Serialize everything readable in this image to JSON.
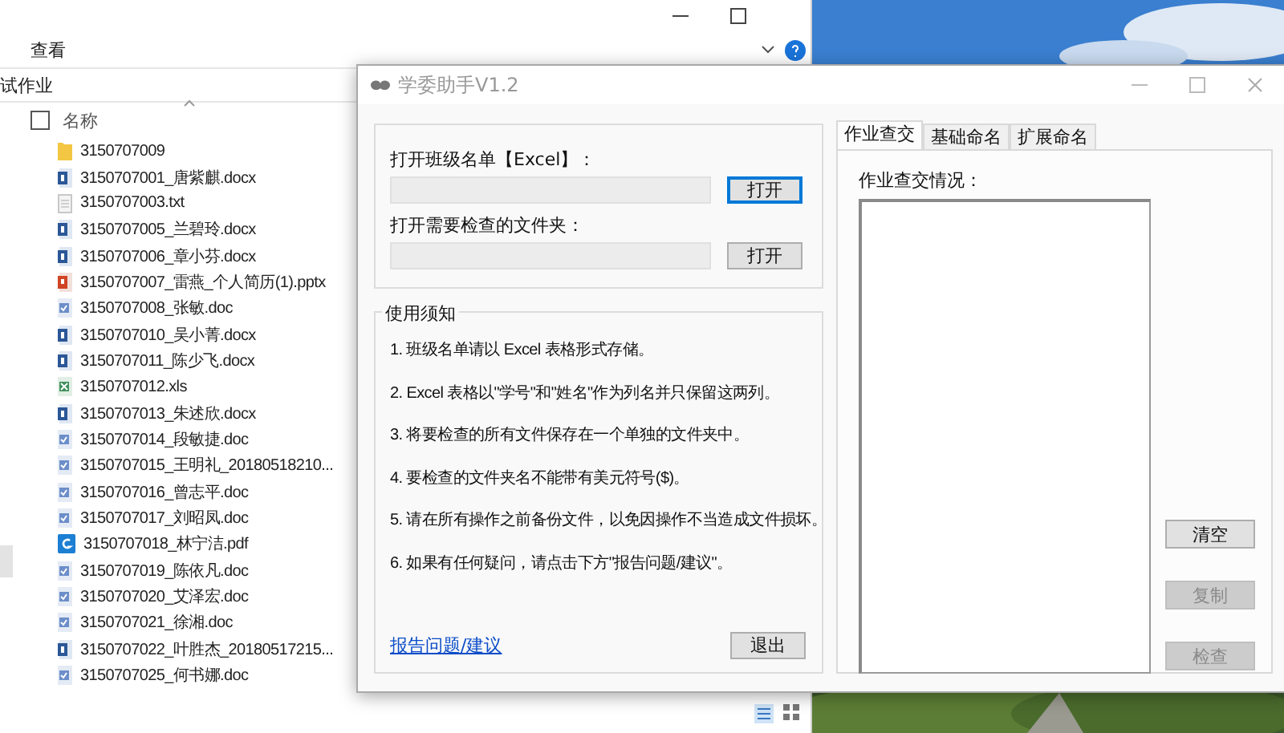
{
  "explorer": {
    "ribbon_tab": "查看",
    "address": "试作业",
    "column_header": "名称",
    "files": [
      {
        "name": "3150707009",
        "kind": "folder"
      },
      {
        "name": "3150707001_唐紫麒.docx",
        "kind": "docx"
      },
      {
        "name": "3150707003.txt",
        "kind": "txt"
      },
      {
        "name": "3150707005_兰碧玲.docx",
        "kind": "docx"
      },
      {
        "name": "3150707006_章小芬.docx",
        "kind": "docx"
      },
      {
        "name": "3150707007_雷燕_个人简历(1).pptx",
        "kind": "pptx"
      },
      {
        "name": "3150707008_张敏.doc",
        "kind": "doc"
      },
      {
        "name": "3150707010_吴小菁.docx",
        "kind": "docx"
      },
      {
        "name": "3150707011_陈少飞.docx",
        "kind": "docx"
      },
      {
        "name": "3150707012.xls",
        "kind": "xls"
      },
      {
        "name": "3150707013_朱述欣.docx",
        "kind": "docx"
      },
      {
        "name": "3150707014_段敏捷.doc",
        "kind": "doc"
      },
      {
        "name": "3150707015_王明礼_20180518210...",
        "kind": "doc"
      },
      {
        "name": "3150707016_曾志平.doc",
        "kind": "doc"
      },
      {
        "name": "3150707017_刘昭凤.doc",
        "kind": "doc"
      },
      {
        "name": "3150707018_林宁洁.pdf",
        "kind": "pdf"
      },
      {
        "name": "3150707019_陈依凡.doc",
        "kind": "doc"
      },
      {
        "name": "3150707020_艾泽宏.doc",
        "kind": "doc"
      },
      {
        "name": "3150707021_徐湘.doc",
        "kind": "doc"
      },
      {
        "name": "3150707022_叶胜杰_20180517215...",
        "kind": "docx"
      },
      {
        "name": "3150707025_何书娜.doc",
        "kind": "doc"
      }
    ]
  },
  "app": {
    "title": "学委助手V1.2",
    "open_fields": [
      {
        "label": "打开班级名单【Excel】：",
        "button": "打开",
        "focused": true
      },
      {
        "label": "打开需要检查的文件夹：",
        "button": "打开",
        "focused": false
      }
    ],
    "notice": {
      "title": "使用须知",
      "items": [
        "1. 班级名单请以 Excel 表格形式存储。",
        "2. Excel 表格以\"学号\"和\"姓名\"作为列名并只保留这两列。",
        "3. 将要检查的所有文件保存在一个单独的文件夹中。",
        "4. 要检查的文件夹名不能带有美元符号($)。",
        "5. 请在所有操作之前备份文件，以免因操作不当造成文件损坏。",
        "6. 如果有任何疑问，请点击下方\"报告问题/建议\"。"
      ],
      "link": "报告问题/建议",
      "exit_button": "退出"
    },
    "tabs": [
      {
        "label": "作业查交",
        "selected": true
      },
      {
        "label": "基础命名",
        "selected": false
      },
      {
        "label": "扩展命名",
        "selected": false
      }
    ],
    "result_label": "作业查交情况：",
    "buttons": [
      {
        "label": "清空",
        "disabled": false
      },
      {
        "label": "复制",
        "disabled": true
      },
      {
        "label": "检查",
        "disabled": true
      }
    ]
  }
}
